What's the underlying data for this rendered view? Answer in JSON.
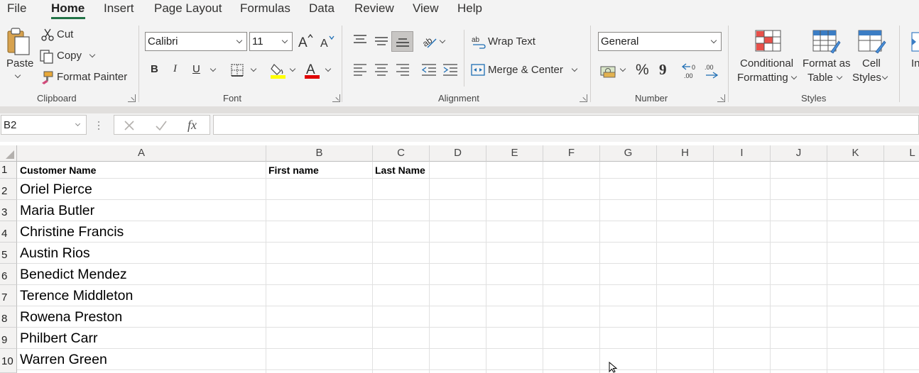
{
  "menu": {
    "tabs": [
      "File",
      "Home",
      "Insert",
      "Page Layout",
      "Formulas",
      "Data",
      "Review",
      "View",
      "Help"
    ],
    "active": "Home"
  },
  "clipboard": {
    "paste_label": "Paste",
    "cut_label": "Cut",
    "copy_label": "Copy",
    "format_painter_label": "Format Painter",
    "group_label": "Clipboard"
  },
  "font": {
    "family": "Calibri",
    "size": "11",
    "bold": "B",
    "italic": "I",
    "underline": "U",
    "group_label": "Font",
    "highlight_color": "#ffff00",
    "font_color": "#e00000"
  },
  "alignment": {
    "wrap_text_label": "Wrap Text",
    "merge_center_label": "Merge & Center",
    "group_label": "Alignment"
  },
  "number": {
    "format": "General",
    "percent": "%",
    "comma": "9",
    "group_label": "Number"
  },
  "styles": {
    "conditional_line1": "Conditional",
    "conditional_line2": "Formatting",
    "format_table_line1": "Format as",
    "format_table_line2": "Table",
    "cell_styles_line1": "Cell",
    "cell_styles_line2": "Styles",
    "group_label": "Styles",
    "insert_partial": "In"
  },
  "formula_bar": {
    "name_box": "B2",
    "fx": "fx",
    "value": ""
  },
  "sheet": {
    "columns": [
      "A",
      "B",
      "C",
      "D",
      "E",
      "F",
      "G",
      "H",
      "I",
      "J",
      "K",
      "L"
    ],
    "rows": [
      "1",
      "2",
      "3",
      "4",
      "5",
      "6",
      "7",
      "8",
      "9",
      "10"
    ],
    "headers": {
      "a1": "Customer Name",
      "b1": "First name",
      "c1": "Last Name"
    },
    "names": [
      "Oriel Pierce",
      "Maria Butler",
      "Christine Francis",
      "Austin Rios",
      "Benedict Mendez",
      "Terence Middleton",
      "Rowena Preston",
      "Philbert Carr",
      "Warren Green"
    ]
  },
  "colors": {
    "accent": "#217346"
  }
}
